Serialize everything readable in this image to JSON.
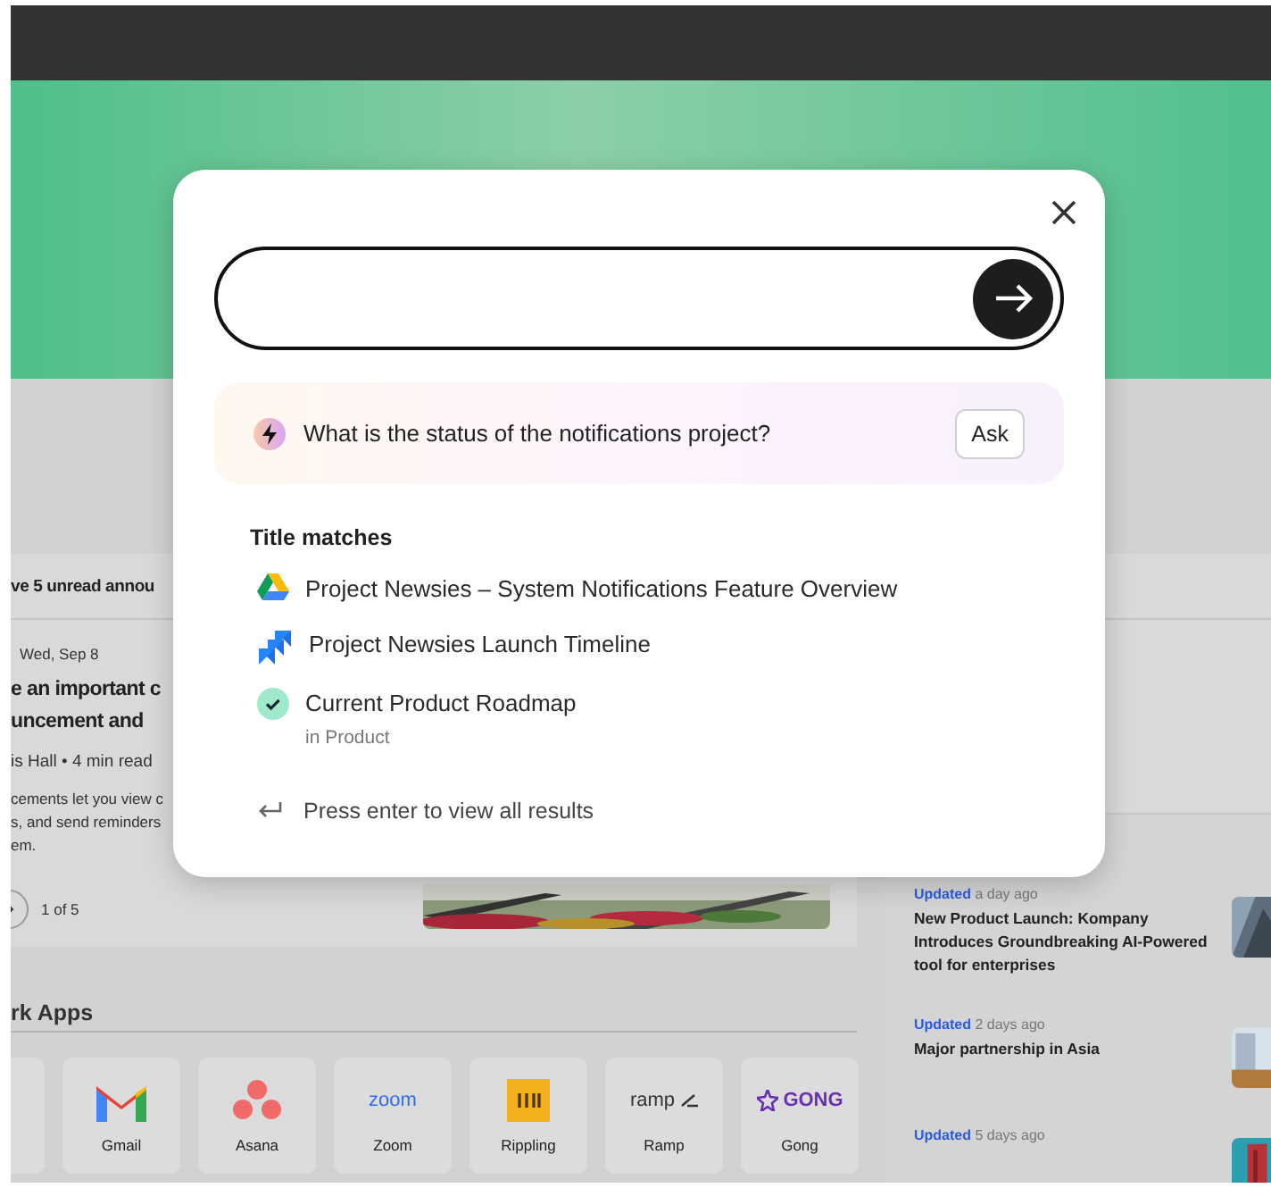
{
  "announcements": {
    "header": "ve 5 unread annou",
    "date": "Wed, Sep 8",
    "title_lines": [
      "e an important c",
      "uncement and"
    ],
    "byline": "is Hall • 4 min read",
    "body_lines": [
      "cements let you view c",
      "s, and send reminders",
      "em."
    ],
    "pager": "1 of 5",
    "picture": {
      "kind": "picture"
    }
  },
  "work_apps": {
    "title": "rk Apps",
    "leading_tile_cut": true,
    "apps": [
      {
        "name": "Gmail",
        "kind": "gmail"
      },
      {
        "name": "Asana",
        "kind": "asana"
      },
      {
        "name": "Zoom",
        "kind": "zoom",
        "logo_text": "zoom"
      },
      {
        "name": "Rippling",
        "kind": "rippling"
      },
      {
        "name": "Ramp",
        "kind": "ramp",
        "logo_text": "ramp"
      },
      {
        "name": "Gong",
        "kind": "gong",
        "logo_text": "GONG"
      }
    ]
  },
  "news": [
    {
      "status": "Updated",
      "time": "a day ago",
      "title": "New Product Launch: Kompany Introduces Groundbreaking AI-Powered tool for enterprises",
      "picture": {
        "kind": "picture"
      }
    },
    {
      "status": "Updated",
      "time": "2 days ago",
      "title": "Major partnership in Asia",
      "picture": {
        "kind": "picture"
      }
    },
    {
      "status": "Updated",
      "time": "5 days ago",
      "picture": {
        "kind": "picture"
      }
    }
  ],
  "search_dialog": {
    "suggestion": {
      "text": "What is the status of the notifications project?",
      "button": "Ask"
    },
    "section_title": "Title matches",
    "results": [
      {
        "title": "Project Newsies – System Notifications Feature Overview",
        "kind": "drive"
      },
      {
        "title": "Project Newsies Launch Timeline",
        "kind": "jira"
      },
      {
        "title": "Current Product Roadmap",
        "subtitle": "in Product",
        "kind": "check"
      }
    ],
    "footer_hint": "Press enter to view all results"
  }
}
